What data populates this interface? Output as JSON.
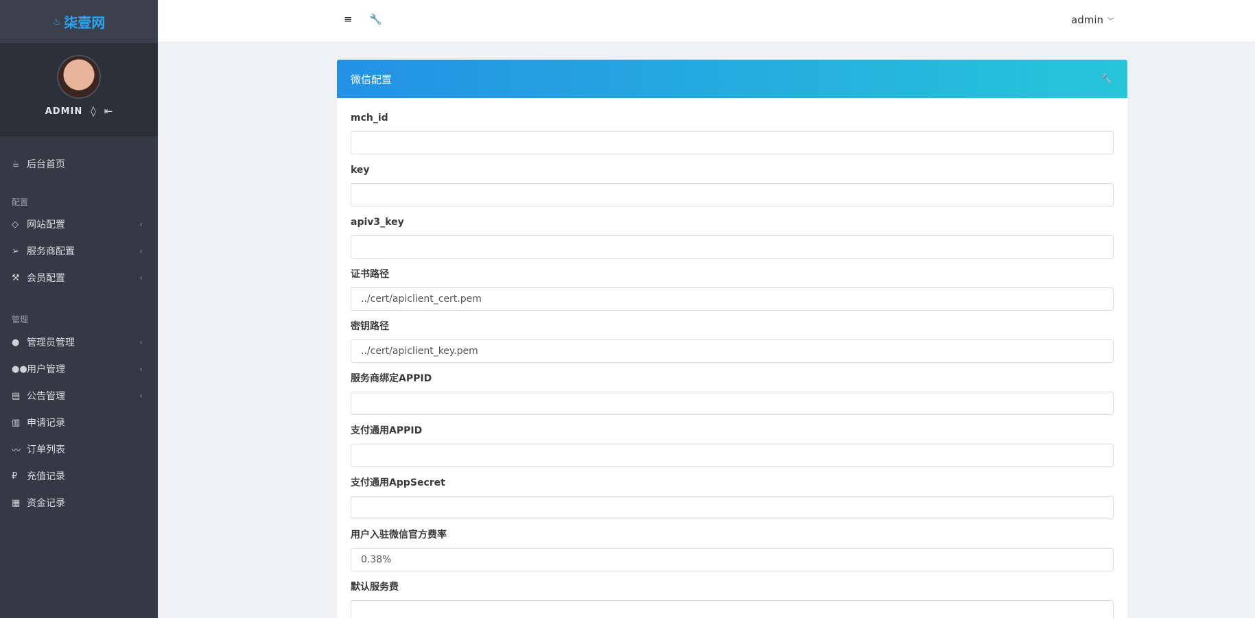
{
  "sidebar": {
    "brand": "柒壹网",
    "brand_icon": "flame-icon",
    "profile": {
      "name": "ADMIN"
    },
    "items": [
      {
        "label": "后台首页",
        "icon": "cup-icon",
        "chevron": false
      },
      {
        "label": "网站配置",
        "icon": "tag-icon",
        "chevron": true
      },
      {
        "label": "服务商配置",
        "icon": "send-icon",
        "chevron": true
      },
      {
        "label": "会员配置",
        "icon": "hammer-icon",
        "chevron": true
      },
      {
        "label": "管理员管理",
        "icon": "user-icon",
        "chevron": true
      },
      {
        "label": "用户管理",
        "icon": "users-icon",
        "chevron": true
      },
      {
        "label": "公告管理",
        "icon": "notice-icon",
        "chevron": true
      },
      {
        "label": "申请记录",
        "icon": "bar-chart-icon",
        "chevron": false
      },
      {
        "label": "订单列表",
        "icon": "line-chart-icon",
        "chevron": false
      },
      {
        "label": "充值记录",
        "icon": "ruble-icon",
        "chevron": false
      },
      {
        "label": "资金记录",
        "icon": "table-icon",
        "chevron": false
      }
    ],
    "headings": [
      "配置",
      "管理"
    ]
  },
  "topbar": {
    "menu_icon": "menu-icon",
    "tools_icon": "wrench-icon",
    "user": "admin"
  },
  "card": {
    "title": "微信配置",
    "header_icon": "wrench-icon",
    "fields": [
      {
        "label": "mch_id",
        "value": ""
      },
      {
        "label": "key",
        "value": ""
      },
      {
        "label": "apiv3_key",
        "value": ""
      },
      {
        "label": "证书路径",
        "value": "../cert/apiclient_cert.pem"
      },
      {
        "label": "密钥路径",
        "value": "../cert/apiclient_key.pem"
      },
      {
        "label": "服务商绑定APPID",
        "value": ""
      },
      {
        "label": "支付通用APPID",
        "value": ""
      },
      {
        "label": "支付通用AppSecret",
        "value": ""
      },
      {
        "label": "用户入驻微信官方费率",
        "value": "0.38%"
      },
      {
        "label": "默认服务费",
        "value": ""
      }
    ]
  },
  "colors": {
    "sidebar_bg": "#343a45",
    "brand": "#2ea3f2",
    "header_gradient_start": "#2391e4",
    "header_gradient_end": "#26c6da"
  }
}
